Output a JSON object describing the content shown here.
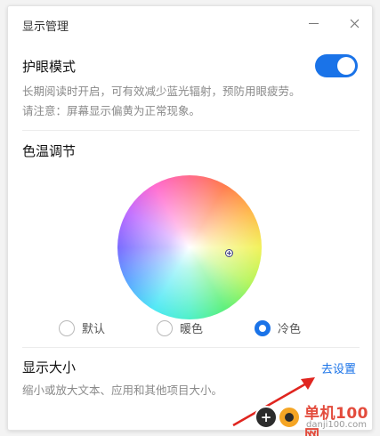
{
  "window": {
    "title": "显示管理"
  },
  "eye_protection": {
    "title": "护眼模式",
    "desc_line1": "长期阅读时开启，可有效减少蓝光辐射，预防用眼疲劳。",
    "desc_line2": "请注意：屏幕显示偏黄为正常现象。",
    "enabled": true
  },
  "color_temperature": {
    "title": "色温调节",
    "options": [
      {
        "label": "默认",
        "checked": false
      },
      {
        "label": "暖色",
        "checked": false
      },
      {
        "label": "冷色",
        "checked": true
      }
    ]
  },
  "display_size": {
    "title": "显示大小",
    "link": "去设置",
    "desc": "缩小或放大文本、应用和其他项目大小。"
  },
  "watermark": {
    "main": "单机100网",
    "sub": "danji100.com"
  },
  "colors": {
    "accent": "#1a73e8",
    "arrow": "#e0251f"
  }
}
